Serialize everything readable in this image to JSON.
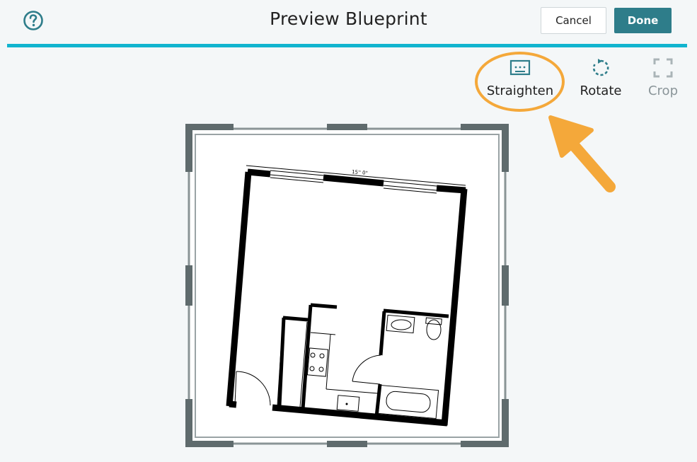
{
  "header": {
    "title": "Preview Blueprint",
    "cancel_label": "Cancel",
    "done_label": "Done",
    "help_icon": "question-circle-icon"
  },
  "toolbar": {
    "tools": [
      {
        "label": "Straighten",
        "icon": "straighten-icon",
        "highlighted": true,
        "enabled": true
      },
      {
        "label": "Rotate",
        "icon": "rotate-icon",
        "enabled": true
      },
      {
        "label": "Crop",
        "icon": "crop-icon",
        "enabled": false
      }
    ]
  },
  "blueprint": {
    "dimension_label": "15'' 0\""
  },
  "colors": {
    "accent": "#11b4cf",
    "done_button": "#2e7d8a",
    "highlight": "#f4a83a",
    "frame": "#5f6b6d",
    "icon": "#2e7d8a"
  }
}
